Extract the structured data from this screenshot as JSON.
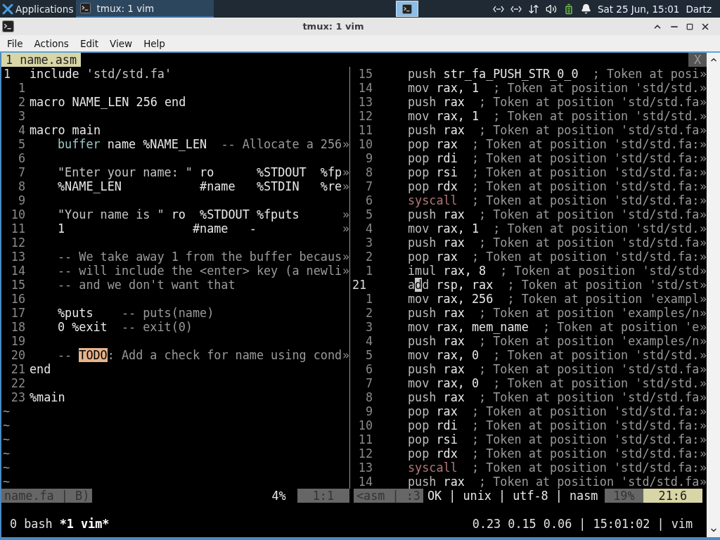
{
  "panel": {
    "apps_label": "Applications",
    "tasks": [
      {
        "label": "tmux: 1 vim",
        "selected": true
      }
    ],
    "clock": "Sat 25 Jun, 15:01",
    "user": "Dartz"
  },
  "window": {
    "title": "tmux: 1 vim",
    "menu": [
      "File",
      "Actions",
      "Edit",
      "View",
      "Help"
    ]
  },
  "vim": {
    "tabs": [
      {
        "label": "1 name.asm",
        "selected": true
      }
    ],
    "close_label": "X",
    "left_pane": {
      "lines": [
        {
          "number": "1",
          "current": true,
          "segments": [
            {
              "text": "include ",
              "kind": "plain"
            },
            {
              "text": "'std/std.fa'",
              "kind": "string"
            }
          ]
        },
        {
          "number": "1",
          "current": false
        },
        {
          "number": "2",
          "current": false,
          "segments": [
            {
              "text": "macro NAME_LEN 256 end",
              "kind": "plain"
            }
          ]
        },
        {
          "number": "3",
          "current": false
        },
        {
          "number": "4",
          "current": false,
          "segments": [
            {
              "text": "macro main",
              "kind": "plain"
            }
          ]
        },
        {
          "number": "5",
          "current": false,
          "indent": true,
          "segments": [
            {
              "text": "buffer",
              "kind": "keyword"
            },
            {
              "text": " name %NAME_LEN",
              "kind": "plain"
            },
            {
              "text": "  -- Allocate a 256",
              "kind": "comment"
            }
          ],
          "more": "»"
        },
        {
          "number": "6",
          "current": false
        },
        {
          "number": "7",
          "current": false,
          "indent": true,
          "segments": [
            {
              "text": "\"Enter your name: \"",
              "kind": "string"
            },
            {
              "text": " ro      %STDOUT  %fp",
              "kind": "plain"
            }
          ],
          "more": "»"
        },
        {
          "number": "8",
          "current": false,
          "indent": true,
          "segments": [
            {
              "text": "%NAME_LEN           #name   %STDIN   %re",
              "kind": "plain"
            }
          ],
          "more": "»"
        },
        {
          "number": "9",
          "current": false
        },
        {
          "number": "10",
          "current": false,
          "indent": true,
          "segments": [
            {
              "text": "\"Your name is \"",
              "kind": "string"
            },
            {
              "text": " ro  %STDOUT %fputs",
              "kind": "plain"
            }
          ],
          "more": "»"
        },
        {
          "number": "11",
          "current": false,
          "indent": true,
          "segments": [
            {
              "text": "1                  #name   -",
              "kind": "plain"
            }
          ],
          "more": "»"
        },
        {
          "number": "12",
          "current": false
        },
        {
          "number": "13",
          "current": false,
          "indent": true,
          "segments": [
            {
              "text": "-- We take away 1 from the buffer becaus",
              "kind": "comment"
            }
          ],
          "more": "»"
        },
        {
          "number": "14",
          "current": false,
          "indent": true,
          "segments": [
            {
              "text": "-- will include the <enter> key (a newli",
              "kind": "comment"
            }
          ],
          "more": "»"
        },
        {
          "number": "15",
          "current": false,
          "indent": true,
          "segments": [
            {
              "text": "-- and we don't want that",
              "kind": "comment"
            }
          ]
        },
        {
          "number": "16",
          "current": false
        },
        {
          "number": "17",
          "current": false,
          "indent": true,
          "segments": [
            {
              "text": "%puts",
              "kind": "plain"
            },
            {
              "text": "    -- puts(name)",
              "kind": "comment"
            }
          ]
        },
        {
          "number": "18",
          "current": false,
          "indent": true,
          "segments": [
            {
              "text": "0 %exit",
              "kind": "plain"
            },
            {
              "text": "  -- exit(0)",
              "kind": "comment"
            }
          ]
        },
        {
          "number": "19",
          "current": false
        },
        {
          "number": "20",
          "current": false,
          "indent": true,
          "segments": [
            {
              "text": "-- ",
              "kind": "comment"
            },
            {
              "text": "TODO",
              "kind": "todo"
            },
            {
              "text": ": Add a check for name using cond",
              "kind": "comment"
            }
          ],
          "more": "»"
        },
        {
          "number": "21",
          "current": false,
          "segments": [
            {
              "text": "end",
              "kind": "plain"
            }
          ]
        },
        {
          "number": "22",
          "current": false
        },
        {
          "number": "23",
          "current": false,
          "segments": [
            {
              "text": "%main",
              "kind": "plain"
            }
          ]
        }
      ],
      "filler": [
        "~",
        "~",
        "~",
        "~",
        "~",
        "~"
      ],
      "status": {
        "file": "name.fa | B)",
        "percent": "4%",
        "position": "1:1",
        "active": false
      }
    },
    "right_pane": {
      "lines": [
        {
          "number": "15",
          "current": false,
          "segments": [
            {
              "text": "push ",
              "kind": "op"
            },
            {
              "text": "str_fa_PUSH_STR_0_0",
              "kind": "plain"
            },
            {
              "text": "  ; Token at posi",
              "kind": "comment"
            }
          ],
          "more": "»"
        },
        {
          "number": "14",
          "current": false,
          "segments": [
            {
              "text": "mov ",
              "kind": "op"
            },
            {
              "text": "rax, 1",
              "kind": "plain"
            },
            {
              "text": "  ; Token at position 'std/std.",
              "kind": "comment"
            }
          ],
          "more": "»"
        },
        {
          "number": "13",
          "current": false,
          "segments": [
            {
              "text": "push ",
              "kind": "op"
            },
            {
              "text": "rax",
              "kind": "plain"
            },
            {
              "text": "  ; Token at position 'std/std.fa",
              "kind": "comment"
            }
          ],
          "more": "»"
        },
        {
          "number": "12",
          "current": false,
          "segments": [
            {
              "text": "mov ",
              "kind": "op"
            },
            {
              "text": "rax, 1",
              "kind": "plain"
            },
            {
              "text": "  ; Token at position 'std/std.",
              "kind": "comment"
            }
          ],
          "more": "»"
        },
        {
          "number": "11",
          "current": false,
          "segments": [
            {
              "text": "push ",
              "kind": "op"
            },
            {
              "text": "rax",
              "kind": "plain"
            },
            {
              "text": "  ; Token at position 'std/std.fa",
              "kind": "comment"
            }
          ],
          "more": "»"
        },
        {
          "number": "10",
          "current": false,
          "segments": [
            {
              "text": "pop ",
              "kind": "op"
            },
            {
              "text": "rax",
              "kind": "plain"
            },
            {
              "text": "  ; Token at position 'std/std.fa:",
              "kind": "comment"
            }
          ],
          "more": "»"
        },
        {
          "number": "9",
          "current": false,
          "segments": [
            {
              "text": "pop ",
              "kind": "op"
            },
            {
              "text": "rdi",
              "kind": "plain"
            },
            {
              "text": "  ; Token at position 'std/std.fa:",
              "kind": "comment"
            }
          ],
          "more": "»"
        },
        {
          "number": "8",
          "current": false,
          "segments": [
            {
              "text": "pop ",
              "kind": "op"
            },
            {
              "text": "rsi",
              "kind": "plain"
            },
            {
              "text": "  ; Token at position 'std/std.fa:",
              "kind": "comment"
            }
          ],
          "more": "»"
        },
        {
          "number": "7",
          "current": false,
          "segments": [
            {
              "text": "pop ",
              "kind": "op"
            },
            {
              "text": "rdx",
              "kind": "plain"
            },
            {
              "text": "  ; Token at position 'std/std.fa:",
              "kind": "comment"
            }
          ],
          "more": "»"
        },
        {
          "number": "6",
          "current": false,
          "segments": [
            {
              "text": "syscall",
              "kind": "syscall"
            },
            {
              "text": "  ; Token at position 'std/std.fa:",
              "kind": "comment"
            }
          ],
          "more": "»"
        },
        {
          "number": "5",
          "current": false,
          "segments": [
            {
              "text": "push ",
              "kind": "op"
            },
            {
              "text": "rax",
              "kind": "plain"
            },
            {
              "text": "  ; Token at position 'std/std.fa",
              "kind": "comment"
            }
          ],
          "more": "»"
        },
        {
          "number": "4",
          "current": false,
          "segments": [
            {
              "text": "mov ",
              "kind": "op"
            },
            {
              "text": "rax, 1",
              "kind": "plain"
            },
            {
              "text": "  ; Token at position 'std/std.",
              "kind": "comment"
            }
          ],
          "more": "»"
        },
        {
          "number": "3",
          "current": false,
          "segments": [
            {
              "text": "push ",
              "kind": "op"
            },
            {
              "text": "rax",
              "kind": "plain"
            },
            {
              "text": "  ; Token at position 'std/std.fa",
              "kind": "comment"
            }
          ],
          "more": "»"
        },
        {
          "number": "2",
          "current": false,
          "segments": [
            {
              "text": "pop ",
              "kind": "op"
            },
            {
              "text": "rax",
              "kind": "plain"
            },
            {
              "text": "  ; Token at position 'std/std.fa:",
              "kind": "comment"
            }
          ],
          "more": "»"
        },
        {
          "number": "1",
          "current": false,
          "segments": [
            {
              "text": "imul ",
              "kind": "op"
            },
            {
              "text": "rax, 8",
              "kind": "plain"
            },
            {
              "text": "  ; Token at position 'std/std",
              "kind": "comment"
            }
          ],
          "more": "»"
        },
        {
          "number": "21",
          "current": true,
          "segments": [
            {
              "text": "a",
              "kind": "op"
            },
            {
              "text": "d",
              "kind": "cursor"
            },
            {
              "text": "d ",
              "kind": "op"
            },
            {
              "text": "rsp, rax",
              "kind": "plain"
            },
            {
              "text": "  ; Token at position 'std/st",
              "kind": "comment"
            }
          ],
          "more": "»"
        },
        {
          "number": "1",
          "current": false,
          "segments": [
            {
              "text": "mov ",
              "kind": "op"
            },
            {
              "text": "rax, 256",
              "kind": "plain"
            },
            {
              "text": "  ; Token at position 'exampl",
              "kind": "comment"
            }
          ],
          "more": "»"
        },
        {
          "number": "2",
          "current": false,
          "segments": [
            {
              "text": "push ",
              "kind": "op"
            },
            {
              "text": "rax",
              "kind": "plain"
            },
            {
              "text": "  ; Token at position 'examples/n",
              "kind": "comment"
            }
          ],
          "more": "»"
        },
        {
          "number": "3",
          "current": false,
          "segments": [
            {
              "text": "mov ",
              "kind": "op"
            },
            {
              "text": "rax, mem_name",
              "kind": "plain"
            },
            {
              "text": "  ; Token at position 'e",
              "kind": "comment"
            }
          ],
          "more": "»"
        },
        {
          "number": "4",
          "current": false,
          "segments": [
            {
              "text": "push ",
              "kind": "op"
            },
            {
              "text": "rax",
              "kind": "plain"
            },
            {
              "text": "  ; Token at position 'examples/n",
              "kind": "comment"
            }
          ],
          "more": "»"
        },
        {
          "number": "5",
          "current": false,
          "segments": [
            {
              "text": "mov ",
              "kind": "op"
            },
            {
              "text": "rax, 0",
              "kind": "plain"
            },
            {
              "text": "  ; Token at position 'std/std.",
              "kind": "comment"
            }
          ],
          "more": "»"
        },
        {
          "number": "6",
          "current": false,
          "segments": [
            {
              "text": "push ",
              "kind": "op"
            },
            {
              "text": "rax",
              "kind": "plain"
            },
            {
              "text": "  ; Token at position 'std/std.fa",
              "kind": "comment"
            }
          ],
          "more": "»"
        },
        {
          "number": "7",
          "current": false,
          "segments": [
            {
              "text": "mov ",
              "kind": "op"
            },
            {
              "text": "rax, 0",
              "kind": "plain"
            },
            {
              "text": "  ; Token at position 'std/std.",
              "kind": "comment"
            }
          ],
          "more": "»"
        },
        {
          "number": "8",
          "current": false,
          "segments": [
            {
              "text": "push ",
              "kind": "op"
            },
            {
              "text": "rax",
              "kind": "plain"
            },
            {
              "text": "  ; Token at position 'std/std.fa",
              "kind": "comment"
            }
          ],
          "more": "»"
        },
        {
          "number": "9",
          "current": false,
          "segments": [
            {
              "text": "pop ",
              "kind": "op"
            },
            {
              "text": "rax",
              "kind": "plain"
            },
            {
              "text": "  ; Token at position 'std/std.fa:",
              "kind": "comment"
            }
          ],
          "more": "»"
        },
        {
          "number": "10",
          "current": false,
          "segments": [
            {
              "text": "pop ",
              "kind": "op"
            },
            {
              "text": "rdi",
              "kind": "plain"
            },
            {
              "text": "  ; Token at position 'std/std.fa:",
              "kind": "comment"
            }
          ],
          "more": "»"
        },
        {
          "number": "11",
          "current": false,
          "segments": [
            {
              "text": "pop ",
              "kind": "op"
            },
            {
              "text": "rsi",
              "kind": "plain"
            },
            {
              "text": "  ; Token at position 'std/std.fa:",
              "kind": "comment"
            }
          ],
          "more": "»"
        },
        {
          "number": "12",
          "current": false,
          "segments": [
            {
              "text": "pop ",
              "kind": "op"
            },
            {
              "text": "rdx",
              "kind": "plain"
            },
            {
              "text": "  ; Token at position 'std/std.fa:",
              "kind": "comment"
            }
          ],
          "more": "»"
        },
        {
          "number": "13",
          "current": false,
          "segments": [
            {
              "text": "syscall",
              "kind": "syscall"
            },
            {
              "text": "  ; Token at position 'std/std.fa:",
              "kind": "comment"
            }
          ],
          "more": "»"
        },
        {
          "number": "14",
          "current": false,
          "segments": [
            {
              "text": "push ",
              "kind": "op"
            },
            {
              "text": "rax",
              "kind": "plain"
            },
            {
              "text": "  ; Token at position 'std/std.fa",
              "kind": "comment"
            }
          ],
          "more": "»"
        }
      ],
      "status": {
        "file": "<asm | :3",
        "info": "OK | unix | utf-8 | nasm",
        "percent": "19%",
        "position": "21:6",
        "active": true
      }
    }
  },
  "tmux": {
    "windows": [
      {
        "label": "0 bash",
        "selected": false
      },
      {
        "label": "*1 vim*",
        "selected": true
      }
    ],
    "right": "0.23 0.15 0.06 | 15:01:02 | vim"
  }
}
